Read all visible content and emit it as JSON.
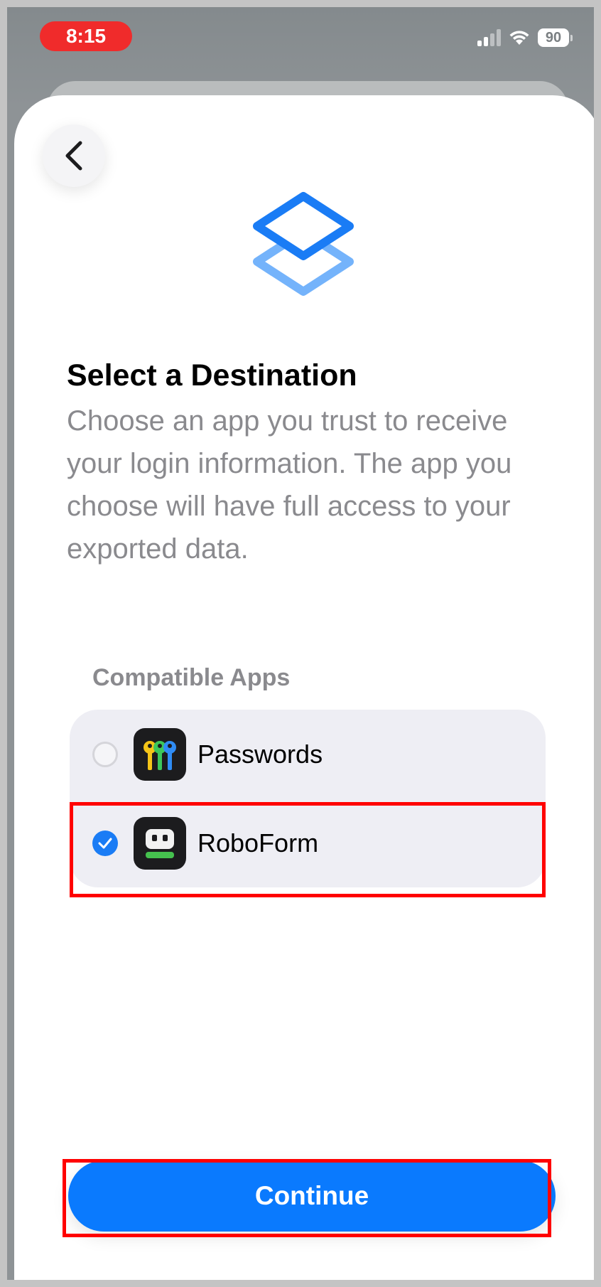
{
  "status_bar": {
    "time": "8:15",
    "battery": "90",
    "signal_icon": "cellular-signal-icon",
    "wifi_icon": "wifi-icon"
  },
  "nav": {
    "back_icon": "chevron-left-icon"
  },
  "header": {
    "icon": "stacked-layers-icon",
    "title": "Select a Destination",
    "description": "Choose an app you trust to receive your login information. The app you choose will have full access to your exported data."
  },
  "apps": {
    "section_label": "Compatible Apps",
    "items": [
      {
        "name": "Passwords",
        "icon": "passwords-keys-icon",
        "selected": false
      },
      {
        "name": "RoboForm",
        "icon": "roboform-icon",
        "selected": true
      }
    ]
  },
  "footer": {
    "continue_label": "Continue"
  },
  "colors": {
    "accent": "#0a7afe",
    "highlight": "#ff0000",
    "status_pill": "#f02b2b"
  }
}
